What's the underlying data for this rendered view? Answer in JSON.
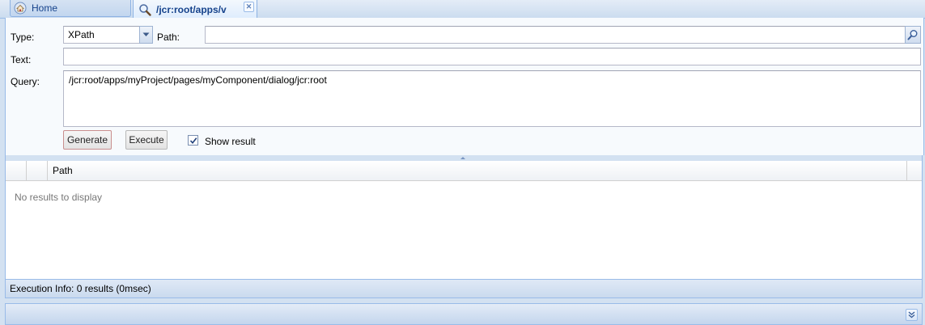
{
  "tabs": [
    {
      "label": "Home",
      "icon": "home-icon"
    },
    {
      "label": "/jcr:root/apps/v",
      "icon": "search-icon",
      "closable": true
    }
  ],
  "form": {
    "type_label": "Type:",
    "type_value": "XPath",
    "path_label": "Path:",
    "path_value": "",
    "text_label": "Text:",
    "text_value": "",
    "query_label": "Query:",
    "query_value": "/jcr:root/apps/myProject/pages/myComponent/dialog/jcr:root"
  },
  "buttons": {
    "generate": "Generate",
    "execute": "Execute"
  },
  "show_result": {
    "label": "Show result",
    "checked": true
  },
  "grid": {
    "columns": [
      "",
      "",
      "Path"
    ],
    "empty_text": "No results to display"
  },
  "footer": {
    "execution_info": "Execution Info: 0 results (0msec)"
  },
  "colors": {
    "accent": "#15428b",
    "panel_border": "#99bbe8",
    "background": "#d3e1f1"
  }
}
